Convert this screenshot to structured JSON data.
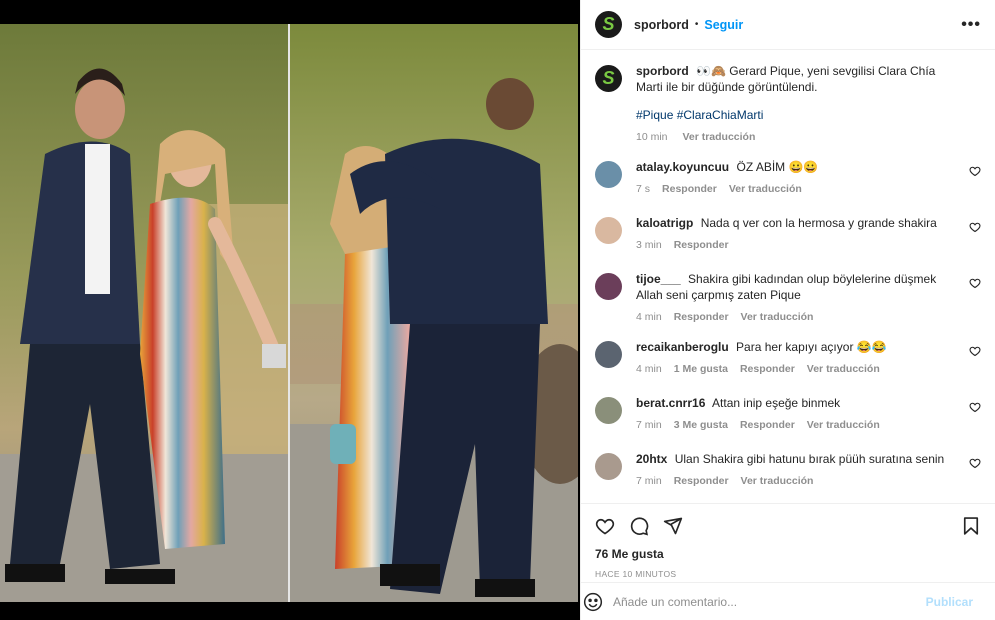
{
  "post": {
    "username": "sporbord",
    "follow_label": "Seguir",
    "more_label": "•••",
    "logo_letter": "S"
  },
  "caption": {
    "username": "sporbord",
    "emoji": "👀🙈",
    "text": "Gerard Pique, yeni sevgilisi Clara Chía Marti ile bir düğünde görüntülendi.",
    "hashtags": "#Pique #ClaraChiaMarti",
    "time": "10 min",
    "translate": "Ver traducción"
  },
  "comments": [
    {
      "username": "atalay.koyuncuu",
      "text": "ÖZ ABİM 😀😀",
      "time": "7 s",
      "likes": "",
      "reply": "Responder",
      "translate": "Ver traducción",
      "avatar_color": "#6a8fa8"
    },
    {
      "username": "kaloatrigp",
      "text": "Nada q ver con la hermosa y grande shakira",
      "time": "3 min",
      "likes": "",
      "reply": "Responder",
      "translate": "",
      "avatar_color": "#d9b8a0"
    },
    {
      "username": "tijoe___",
      "text": "Shakira gibi kadından olup böylelerine düşmek Allah seni çarpmış zaten Pique",
      "time": "4 min",
      "likes": "",
      "reply": "Responder",
      "translate": "Ver traducción",
      "avatar_color": "#6b3e5a"
    },
    {
      "username": "recaikanberoglu",
      "text": "Para her kapıyı açıyor 😂😂",
      "time": "4 min",
      "likes": "1 Me gusta",
      "reply": "Responder",
      "translate": "Ver traducción",
      "avatar_color": "#5b6470"
    },
    {
      "username": "berat.cnrr16",
      "text": "Attan inip eşeğe binmek",
      "time": "7 min",
      "likes": "3 Me gusta",
      "reply": "Responder",
      "translate": "Ver traducción",
      "avatar_color": "#8a8f7a"
    },
    {
      "username": "20htx",
      "text": "Ulan Shakira gibi hatunu bırak püüh suratına senin",
      "time": "7 min",
      "likes": "",
      "reply": "Responder",
      "translate": "Ver traducción",
      "avatar_color": "#a99a8e"
    }
  ],
  "actions": {
    "like_icon": "heart-icon",
    "comment_icon": "comment-icon",
    "share_icon": "share-icon",
    "save_icon": "bookmark-icon"
  },
  "likes_text": "76 Me gusta",
  "time_ago": "HACE 10 MINUTOS",
  "add_comment": {
    "placeholder": "Añade un comentario...",
    "publish_label": "Publicar"
  },
  "colors": {
    "accent": "#0095f6",
    "logo_green": "#7ac943",
    "muted": "#8e8e8e",
    "hashtag": "#00376b"
  }
}
